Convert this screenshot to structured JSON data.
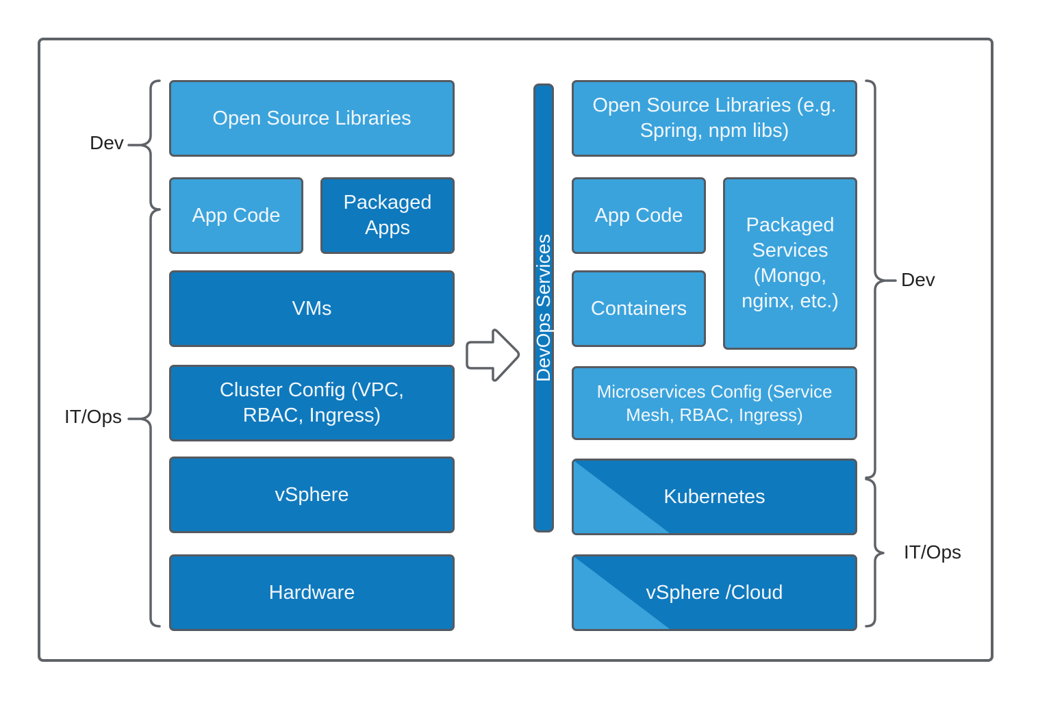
{
  "colors": {
    "light_box": "#3aa3dc",
    "dark_box": "#0f79bd",
    "outline": "#555a60",
    "text": "#f2f7fb",
    "label": "#222222"
  },
  "left_stack": {
    "open_source_libraries": "Open Source Libraries",
    "app_code": "App Code",
    "packaged_apps": "Packaged Apps",
    "vms": "VMs",
    "cluster_config": "Cluster Config (VPC, RBAC, Ingress)",
    "vsphere": "vSphere",
    "hardware": "Hardware",
    "brace_labels": {
      "dev": "Dev",
      "itops": "IT/Ops"
    }
  },
  "arrow": {
    "icon": "right-arrow-icon"
  },
  "devops_bar": {
    "label": "DevOps Services"
  },
  "right_stack": {
    "open_source_libraries": "Open Source Libraries (e.g. Spring, npm libs)",
    "app_code": "App Code",
    "packaged_services": "Packaged Services (Mongo, nginx, etc.)",
    "containers": "Containers",
    "microservices_config": "Microservices Config (Service Mesh, RBAC, Ingress)",
    "kubernetes": "Kubernetes",
    "vsphere_cloud": "vSphere /Cloud",
    "brace_labels": {
      "dev": "Dev",
      "itops": "IT/Ops"
    }
  }
}
